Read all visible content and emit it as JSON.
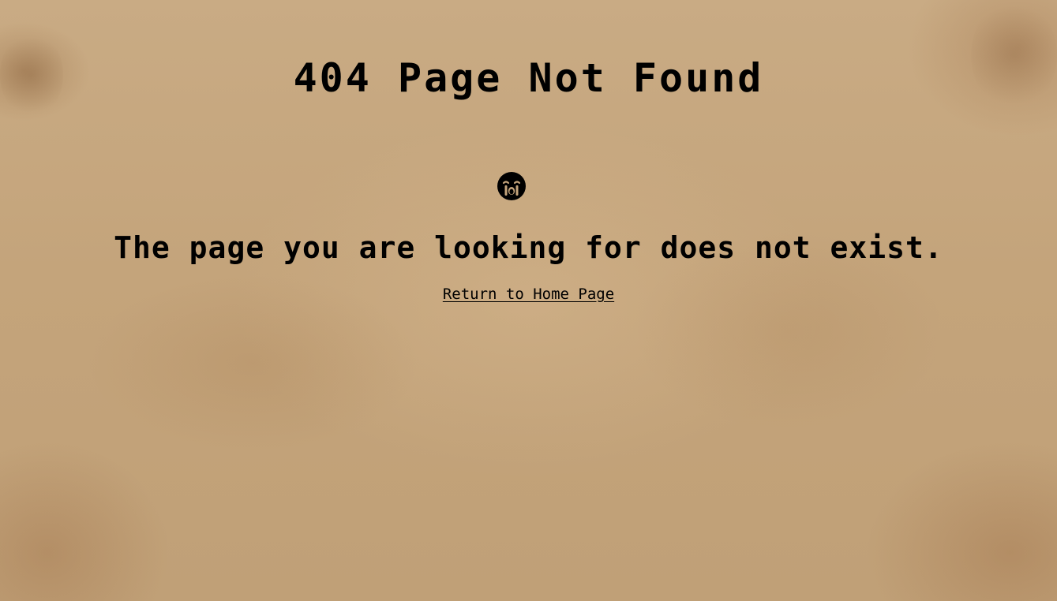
{
  "page": {
    "title": "404 Page Not Found",
    "icon": "crying-face-icon",
    "message": "The page you are looking for does not exist.",
    "link_label": "Return to Home Page"
  },
  "colors": {
    "background": "#c4a47b",
    "text": "#000000"
  }
}
